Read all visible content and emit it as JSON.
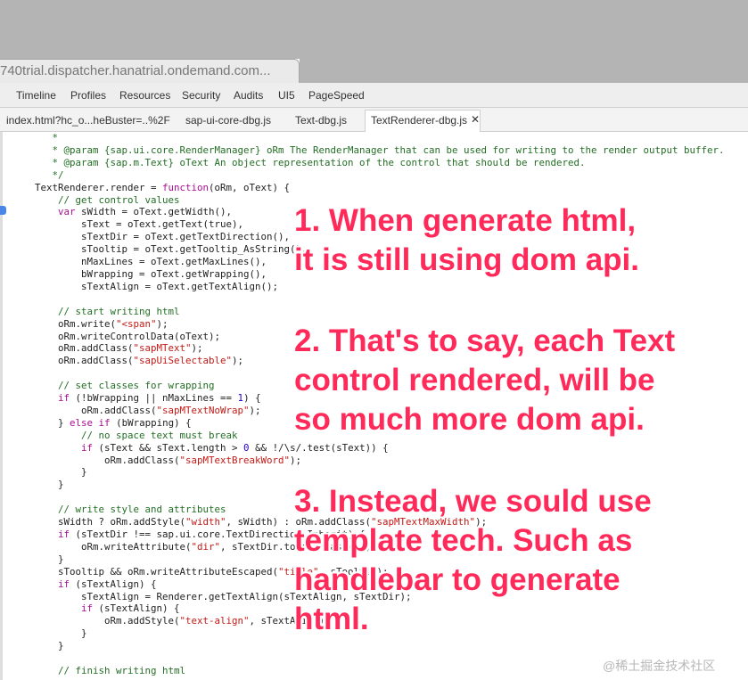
{
  "url": "740trial.dispatcher.hanatrial.ondemand.com...",
  "devtools_tabs": [
    "Timeline",
    "Profiles",
    "Resources",
    "Security",
    "Audits",
    "UI5",
    "PageSpeed"
  ],
  "file_tabs": [
    "index.html?hc_o...heBuster=..%2F",
    "sap-ui-core-dbg.js",
    "Text-dbg.js",
    "TextRenderer-dbg.js"
  ],
  "close_glyph": "✕",
  "code_lines": [
    "         *",
    "         * @param {sap.ui.core.RenderManager} oRm The RenderManager that can be used for writing to the render output buffer.",
    "         * @param {sap.m.Text} oText An object representation of the control that should be rendered.",
    "         */",
    "      TextRenderer.render = function(oRm, oText) {",
    "          // get control values",
    "          var sWidth = oText.getWidth(),",
    "              sText = oText.getText(true),",
    "              sTextDir = oText.getTextDirection(),",
    "              sTooltip = oText.getTooltip_AsString(),",
    "              nMaxLines = oText.getMaxLines(),",
    "              bWrapping = oText.getWrapping(),",
    "              sTextAlign = oText.getTextAlign();",
    "",
    "          // start writing html",
    "          oRm.write(\"<span\");",
    "          oRm.writeControlData(oText);",
    "          oRm.addClass(\"sapMText\");",
    "          oRm.addClass(\"sapUiSelectable\");",
    "",
    "          // set classes for wrapping",
    "          if (!bWrapping || nMaxLines == 1) {",
    "              oRm.addClass(\"sapMTextNoWrap\");",
    "          } else if (bWrapping) {",
    "              // no space text must break",
    "              if (sText && sText.length > 0 && !/\\s/.test(sText)) {",
    "                  oRm.addClass(\"sapMTextBreakWord\");",
    "              }",
    "          }",
    "",
    "          // write style and attributes",
    "          sWidth ? oRm.addStyle(\"width\", sWidth) : oRm.addClass(\"sapMTextMaxWidth\");",
    "          if (sTextDir !== sap.ui.core.TextDirection.Inherit) {",
    "              oRm.writeAttribute(\"dir\", sTextDir.toLowerCase());",
    "          }",
    "          sTooltip && oRm.writeAttributeEscaped(\"title\", sTooltip);",
    "          if (sTextAlign) {",
    "              sTextAlign = Renderer.getTextAlign(sTextAlign, sTextDir);",
    "              if (sTextAlign) {",
    "                  oRm.addStyle(\"text-align\", sTextAlign);",
    "              }",
    "          }",
    "",
    "          // finish writing html"
  ],
  "annotations": [
    {
      "lines": [
        "1. When generate html,",
        "it is still using dom api."
      ]
    },
    {
      "lines": [
        "2. That's to say, each Text",
        "control rendered, will be",
        "so much more dom api."
      ]
    },
    {
      "lines": [
        "3. Instead, we sould use",
        "template tech. Such as",
        "handlebar to generate",
        "html."
      ]
    }
  ],
  "watermark": "@稀土掘金技术社区",
  "colors": {
    "annotation": "#ff2a59",
    "comment": "#236e25",
    "string": "#c41a16",
    "keyword": "#aa0d91"
  }
}
